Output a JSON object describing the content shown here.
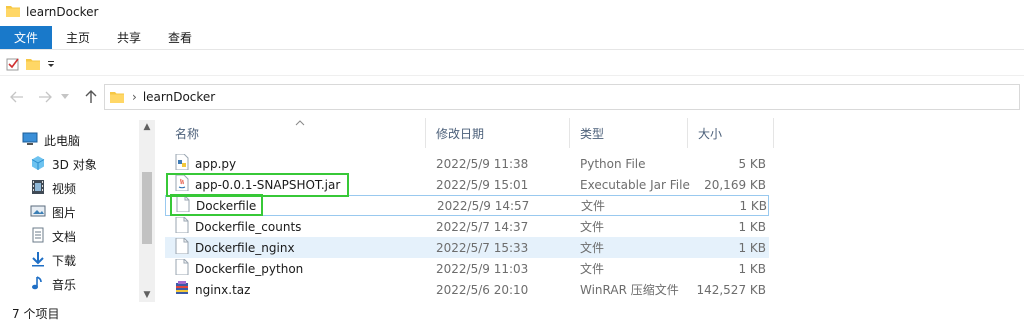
{
  "window": {
    "title": "learnDocker"
  },
  "ribbon": {
    "file_tab": "文件",
    "tabs": [
      "主页",
      "共享",
      "查看"
    ]
  },
  "address": {
    "crumb": "learnDocker"
  },
  "nav_pane": {
    "root": "此电脑",
    "items": [
      {
        "label": "3D 对象",
        "icon": "3d-objects-icon"
      },
      {
        "label": "视频",
        "icon": "video-icon"
      },
      {
        "label": "图片",
        "icon": "pictures-icon"
      },
      {
        "label": "文档",
        "icon": "documents-icon"
      },
      {
        "label": "下载",
        "icon": "download-icon"
      },
      {
        "label": "音乐",
        "icon": "music-icon"
      }
    ]
  },
  "columns": {
    "name": "名称",
    "date": "修改日期",
    "type": "类型",
    "size": "大小"
  },
  "files": [
    {
      "name": "app.py",
      "date": "2022/5/9 11:38",
      "type": "Python File",
      "size": "5 KB",
      "icon": "python-file-icon"
    },
    {
      "name": "app-0.0.1-SNAPSHOT.jar",
      "date": "2022/5/9 15:01",
      "type": "Executable Jar File",
      "size": "20,169 KB",
      "icon": "jar-file-icon"
    },
    {
      "name": "Dockerfile",
      "date": "2022/5/9 14:57",
      "type": "文件",
      "size": "1 KB",
      "icon": "file-icon"
    },
    {
      "name": "Dockerfile_counts",
      "date": "2022/5/7 14:37",
      "type": "文件",
      "size": "1 KB",
      "icon": "file-icon"
    },
    {
      "name": "Dockerfile_nginx",
      "date": "2022/5/7 15:33",
      "type": "文件",
      "size": "1 KB",
      "icon": "file-icon"
    },
    {
      "name": "Dockerfile_python",
      "date": "2022/5/9 11:03",
      "type": "文件",
      "size": "1 KB",
      "icon": "file-icon"
    },
    {
      "name": "nginx.taz",
      "date": "2022/5/6 20:10",
      "type": "WinRAR 压缩文件",
      "size": "142,527 KB",
      "icon": "winrar-archive-icon"
    }
  ],
  "status": {
    "item_count": "7 个项目"
  },
  "colors": {
    "accent": "#1979ca",
    "selection": "#e5f1fb",
    "highlight": "#37c837"
  }
}
